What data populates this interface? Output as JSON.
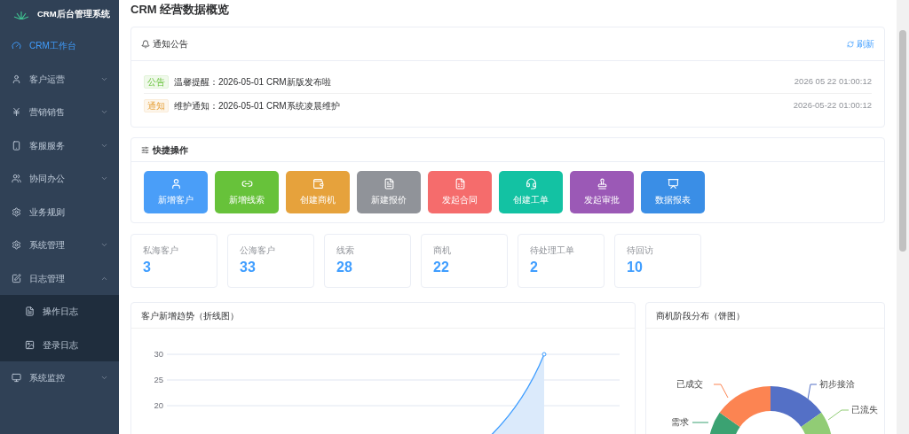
{
  "sidebar": {
    "logo_text": "CRM后台管理系统",
    "items": [
      {
        "label": "CRM工作台",
        "selected": true
      },
      {
        "label": "客户运营",
        "selected": false,
        "expanded": false
      },
      {
        "label": "营销销售",
        "selected": false,
        "expanded": false
      },
      {
        "label": "客服服务",
        "selected": false,
        "expanded": false
      },
      {
        "label": "协同办公",
        "selected": false,
        "expanded": false
      },
      {
        "label": "业务规则",
        "selected": false
      },
      {
        "label": "系统管理",
        "selected": false,
        "expanded": false
      },
      {
        "label": "日志管理",
        "selected": false,
        "expanded": true,
        "children": [
          {
            "label": "操作日志",
            "selected": false
          },
          {
            "label": "登录日志",
            "selected": false
          }
        ]
      },
      {
        "label": "系统监控",
        "selected": false,
        "expanded": false
      }
    ]
  },
  "page_title": "CRM 经营数据概览",
  "notices": {
    "title": "通知公告",
    "refresh": "刷新",
    "items": [
      {
        "tag": "公告",
        "kind": "announcement",
        "text": "温馨提醒：2026-05-01 CRM新版发布啦",
        "time": "2026 05 22 01:00:12"
      },
      {
        "tag": "通知",
        "kind": "notice",
        "text": "维护通知：2026-05-01 CRM系统凌晨维护",
        "time": "2026-05-22 01:00:12"
      }
    ]
  },
  "quick_actions": {
    "title": "快捷操作",
    "items": [
      {
        "label": "新增客户",
        "color": "#4a9ef8"
      },
      {
        "label": "新增线索",
        "color": "#67c23a"
      },
      {
        "label": "创建商机",
        "color": "#e6a23c"
      },
      {
        "label": "新建报价",
        "color": "#909399"
      },
      {
        "label": "发起合同",
        "color": "#f56c6c"
      },
      {
        "label": "创建工单",
        "color": "#13c2a3"
      },
      {
        "label": "发起审批",
        "color": "#9b59b6"
      },
      {
        "label": "数据报表",
        "color": "#3a8ee6"
      }
    ]
  },
  "stats": [
    {
      "label": "私海客户",
      "value": "3"
    },
    {
      "label": "公海客户",
      "value": "33"
    },
    {
      "label": "线索",
      "value": "28"
    },
    {
      "label": "商机",
      "value": "22"
    },
    {
      "label": "待处理工单",
      "value": "2"
    },
    {
      "label": "待回访",
      "value": "10"
    }
  ],
  "line_chart": {
    "title": "客户新增趋势（折线图）",
    "y_ticks": [
      "30",
      "25",
      "20"
    ]
  },
  "pie_chart": {
    "title": "商机阶段分布（饼图）",
    "labels": [
      {
        "text": "初步接洽",
        "color": "#5470c6"
      },
      {
        "text": "已流失",
        "color": "#91cc75"
      },
      {
        "text": "需求",
        "color": "#3ba272"
      },
      {
        "text": "已成交",
        "color": "#fc8452"
      }
    ]
  }
}
